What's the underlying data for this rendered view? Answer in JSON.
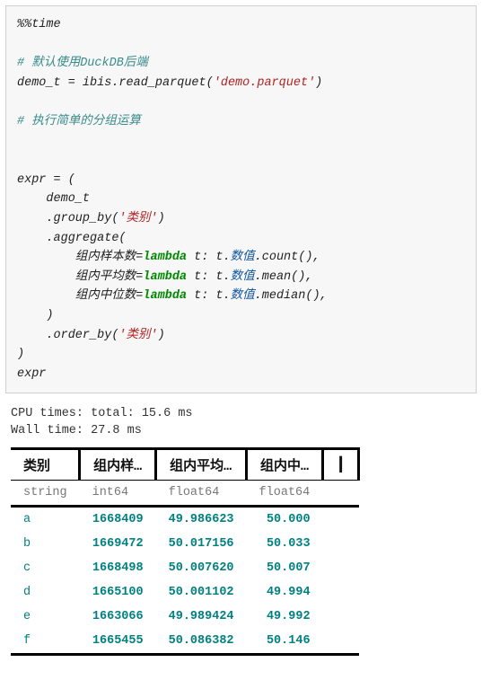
{
  "code": {
    "magic": "%%time",
    "c1": "# 默认使用DuckDB后端",
    "line_assign": "demo_t = ibis.read_parquet(",
    "str_file": "'demo.parquet'",
    "line_assign_end": ")",
    "c2": "# 执行简单的分组运算",
    "expr_open": "expr = (",
    "l_demo": "    demo_t",
    "l_gb": "    .group_by(",
    "str_cat": "'类别'",
    "close_paren": ")",
    "l_agg": "    .aggregate(",
    "agg1_a": "        组内样本数=",
    "agg1_kw": "lambda",
    "agg1_b": " t: t.",
    "agg1_attr": "数值",
    "agg1_c": ".count(),",
    "agg2_a": "        组内平均数=",
    "agg2_c": ".mean(),",
    "agg3_a": "        组内中位数=",
    "agg3_c": ".median(),",
    "l_close": "    )",
    "l_order": "    .order_by(",
    "expr_close": ")",
    "expr_var": "expr"
  },
  "stdout": {
    "cpu": "CPU times: total: 15.6 ms",
    "wall": "Wall time: 27.8 ms"
  },
  "table": {
    "headers": [
      "类别",
      "组内样…",
      "组内平均…",
      "组内中…"
    ],
    "trailer": "┃",
    "types": [
      "string",
      "int64",
      "float64",
      "float64"
    ],
    "rows": [
      {
        "cat": "a",
        "n": "1668409",
        "mean": "49.986623",
        "med": "50.000"
      },
      {
        "cat": "b",
        "n": "1669472",
        "mean": "50.017156",
        "med": "50.033"
      },
      {
        "cat": "c",
        "n": "1668498",
        "mean": "50.007620",
        "med": "50.007"
      },
      {
        "cat": "d",
        "n": "1665100",
        "mean": "50.001102",
        "med": "49.994"
      },
      {
        "cat": "e",
        "n": "1663066",
        "mean": "49.989424",
        "med": "49.992"
      },
      {
        "cat": "f",
        "n": "1665455",
        "mean": "50.086382",
        "med": "50.146"
      }
    ]
  }
}
